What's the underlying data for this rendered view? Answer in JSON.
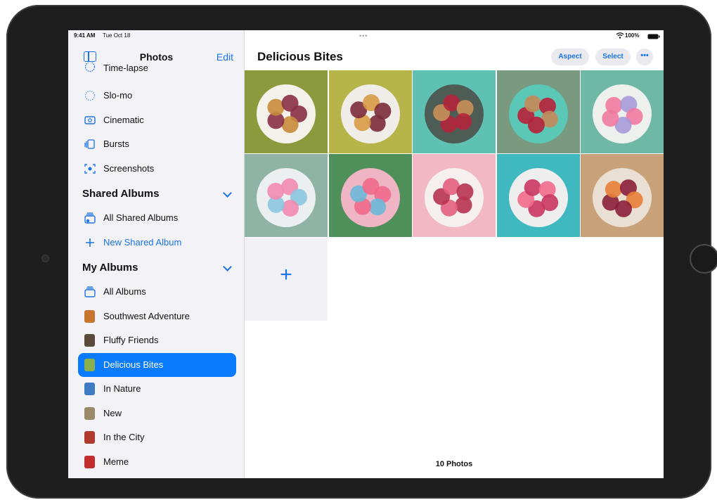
{
  "status_bar": {
    "time": "9:41 AM",
    "date": "Tue Oct 18",
    "battery": "100%"
  },
  "sidebar": {
    "title": "Photos",
    "edit_label": "Edit",
    "media_types": [
      {
        "label": "Time-lapse",
        "icon": "time-lapse-icon"
      },
      {
        "label": "Slo-mo",
        "icon": "slo-mo-icon"
      },
      {
        "label": "Cinematic",
        "icon": "cinematic-icon"
      },
      {
        "label": "Bursts",
        "icon": "bursts-icon"
      },
      {
        "label": "Screenshots",
        "icon": "screenshots-icon"
      }
    ],
    "shared_albums": {
      "heading": "Shared Albums",
      "items": [
        {
          "label": "All Shared Albums",
          "icon": "shared-album-icon"
        },
        {
          "label": "New Shared Album",
          "icon": "plus-icon"
        }
      ]
    },
    "my_albums": {
      "heading": "My Albums",
      "items": [
        {
          "label": "All Albums",
          "icon": "albums-icon"
        },
        {
          "label": "Southwest Adventure",
          "thumb": "#c8762f"
        },
        {
          "label": "Fluffy Friends",
          "thumb": "#5a4a3a"
        },
        {
          "label": "Delicious Bites",
          "thumb": "#8ab04d",
          "selected": true
        },
        {
          "label": "In Nature",
          "thumb": "#3f7cc4"
        },
        {
          "label": "New",
          "thumb": "#9b8a6a"
        },
        {
          "label": "In the City",
          "thumb": "#b13a2f"
        },
        {
          "label": "Meme",
          "thumb": "#c22d2d"
        }
      ]
    }
  },
  "main": {
    "title": "Delicious Bites",
    "aspect_label": "Aspect",
    "select_label": "Select",
    "more_label": "•••",
    "add_label": "+",
    "photo_count": "10 Photos",
    "photos": [
      {
        "bg": "#8b9a3c",
        "plate": "#f4f0ea",
        "food": "#c98a3a",
        "accent": "#8a3046"
      },
      {
        "bg": "#b7b54a",
        "plate": "#f0ede8",
        "food": "#d89a45",
        "accent": "#7a2b3a"
      },
      {
        "bg": "#5fc1b4",
        "plate": "#4d5d55",
        "food": "#c99058",
        "accent": "#b3253a"
      },
      {
        "bg": "#7a9a7f",
        "plate": "#5bc7b7",
        "food": "#c4895a",
        "accent": "#b7203a"
      },
      {
        "bg": "#6fb8a5",
        "plate": "#eef0ee",
        "food": "#a79ad8",
        "accent": "#f07aa0"
      },
      {
        "bg": "#8fb3a5",
        "plate": "#eceff0",
        "food": "#8cc6e0",
        "accent": "#f28ab0"
      },
      {
        "bg": "#4f8f5a",
        "plate": "#efb5c5",
        "food": "#6cb8d8",
        "accent": "#f06a8a"
      },
      {
        "bg": "#f2b8c3",
        "plate": "#f5f0ee",
        "food": "#e35f7f",
        "accent": "#b8324f"
      },
      {
        "bg": "#3fb8c0",
        "plate": "#eeeeee",
        "food": "#f06a8a",
        "accent": "#c93660"
      },
      {
        "bg": "#c9a27a",
        "plate": "#eadfd3",
        "food": "#e87f3a",
        "accent": "#8a1f3a"
      }
    ]
  }
}
